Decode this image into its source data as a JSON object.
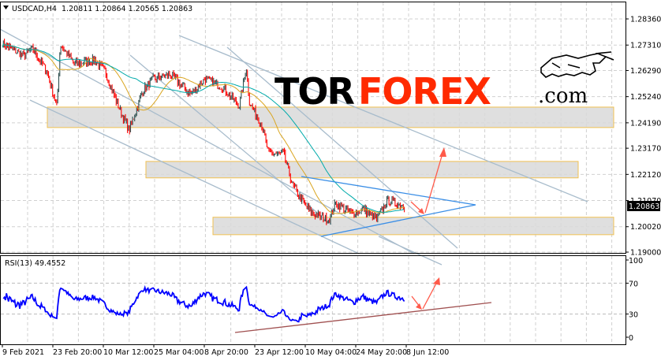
{
  "header": {
    "symbol": "USDCAD,H4",
    "ohlc": "1.20811 1.20864 1.20565 1.20863"
  },
  "logo": {
    "part1": "TOR",
    "part2": "FOREX",
    "suffix": ".com",
    "icon": "bull-icon"
  },
  "colors": {
    "bull_candle": "#2f4f4f",
    "bear_candle": "#ff0000",
    "ma_fast": "#daa520",
    "ma_slow": "#00aaaa",
    "rsi_line": "#0000ff",
    "zone_fill": "#d9d9d9",
    "zone_border": "#f0c050",
    "trendline": "#a8bccc",
    "triangle": "#3a8ee6",
    "arrow": "#ff5a4a",
    "rsi_trendline": "#a05050"
  },
  "chart_data": [
    {
      "type": "candlestick",
      "title": "USDCAD,H4",
      "y_ticks": [
        "1.28360",
        "1.27310",
        "1.26290",
        "1.25240",
        "1.24190",
        "1.23170",
        "1.22120",
        "1.21070",
        "1.20020",
        "1.19000"
      ],
      "ylim": [
        1.19,
        1.2836
      ],
      "current_price": "1.20863",
      "x_ticks": [
        {
          "label": "9 Feb 2021",
          "t": "2021-02-09T00:00"
        },
        {
          "label": "23 Feb 20:00",
          "t": "2021-02-23T20:00"
        },
        {
          "label": "10 Mar 12:00",
          "t": "2021-03-10T12:00"
        },
        {
          "label": "25 Mar 04:00",
          "t": "2021-03-25T04:00"
        },
        {
          "label": "8 Apr 20:00",
          "t": "2021-04-08T20:00"
        },
        {
          "label": "23 Apr 12:00",
          "t": "2021-04-23T12:00"
        },
        {
          "label": "10 May 04:00",
          "t": "2021-05-10T04:00"
        },
        {
          "label": "24 May 20:00",
          "t": "2021-05-24T20:00"
        },
        {
          "label": "8 Jun 12:00",
          "t": "2021-06-08T12:00"
        }
      ],
      "close_path": [
        [
          "2021-02-09",
          1.2738
        ],
        [
          "2021-02-15",
          1.269
        ],
        [
          "2021-02-18",
          1.2715
        ],
        [
          "2021-02-22",
          1.2627
        ],
        [
          "2021-02-25",
          1.2485
        ],
        [
          "2021-02-26",
          1.2735
        ],
        [
          "2021-03-02",
          1.2656
        ],
        [
          "2021-03-08",
          1.2672
        ],
        [
          "2021-03-11",
          1.2625
        ],
        [
          "2021-03-15",
          1.248
        ],
        [
          "2021-03-18",
          1.239
        ],
        [
          "2021-03-22",
          1.2548
        ],
        [
          "2021-03-25",
          1.2596
        ],
        [
          "2021-03-30",
          1.2612
        ],
        [
          "2021-04-05",
          1.2533
        ],
        [
          "2021-04-09",
          1.2596
        ],
        [
          "2021-04-14",
          1.2564
        ],
        [
          "2021-04-19",
          1.2485
        ],
        [
          "2021-04-21",
          1.2643
        ],
        [
          "2021-04-22",
          1.25
        ],
        [
          "2021-04-26",
          1.2405
        ],
        [
          "2021-04-28",
          1.2296
        ],
        [
          "2021-05-03",
          1.2296
        ],
        [
          "2021-05-06",
          1.2169
        ],
        [
          "2021-05-10",
          1.209
        ],
        [
          "2021-05-12",
          1.2058
        ],
        [
          "2021-05-17",
          1.2027
        ],
        [
          "2021-05-19",
          1.2096
        ],
        [
          "2021-05-24",
          1.2052
        ],
        [
          "2021-05-27",
          1.2074
        ],
        [
          "2021-05-31",
          1.2033
        ],
        [
          "2021-06-03",
          1.2106
        ],
        [
          "2021-06-08",
          1.2086
        ]
      ],
      "zones": [
        {
          "from": 1.24,
          "to": 1.2482
        },
        {
          "from": 1.2198,
          "to": 1.2264
        },
        {
          "from": 1.197,
          "to": 1.204
        }
      ]
    },
    {
      "type": "line",
      "title": "RSI(13) 49.4552",
      "y_ticks": [
        "100",
        "70",
        "30",
        "0"
      ],
      "ylim": [
        0,
        100
      ],
      "levels": [
        70,
        30
      ]
    }
  ]
}
